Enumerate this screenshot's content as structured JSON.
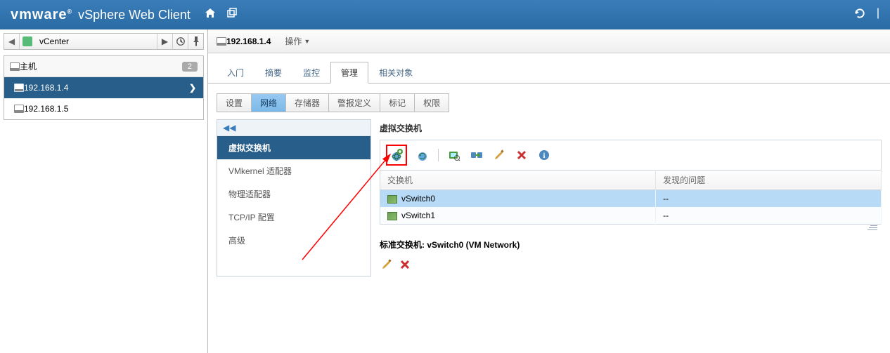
{
  "header": {
    "logo": "vmware",
    "tm": "®",
    "title": "vSphere Web Client"
  },
  "left": {
    "breadcrumb": "vCenter",
    "group_label": "主机",
    "group_count": "2",
    "hosts": [
      {
        "ip": "192.168.1.4",
        "selected": true
      },
      {
        "ip": "192.168.1.5",
        "selected": false
      }
    ]
  },
  "object": {
    "ip": "192.168.1.4",
    "actions_label": "操作"
  },
  "tabs": [
    "入门",
    "摘要",
    "监控",
    "管理",
    "相关对象"
  ],
  "tabs_selected": 3,
  "subtabs": [
    "设置",
    "网络",
    "存储器",
    "警报定义",
    "标记",
    "权限"
  ],
  "subtabs_selected": 1,
  "sidenav": {
    "items": [
      "虚拟交换机",
      "VMkernel 适配器",
      "物理适配器",
      "TCP/IP 配置",
      "高级"
    ],
    "selected": 0
  },
  "section": {
    "title": "虚拟交换机",
    "columns": [
      "交换机",
      "发现的问题"
    ],
    "rows": [
      {
        "name": "vSwitch0",
        "issues": "--",
        "selected": true
      },
      {
        "name": "vSwitch1",
        "issues": "--",
        "selected": false
      }
    ]
  },
  "detail": {
    "title": "标准交换机: vSwitch0 (VM Network)"
  },
  "icons": {
    "add_network": "add-host-networking",
    "refresh": "refresh",
    "manage_adapters": "manage-physical-adapters",
    "migrate": "migrate-networking",
    "edit": "edit",
    "delete": "delete",
    "info": "info"
  }
}
